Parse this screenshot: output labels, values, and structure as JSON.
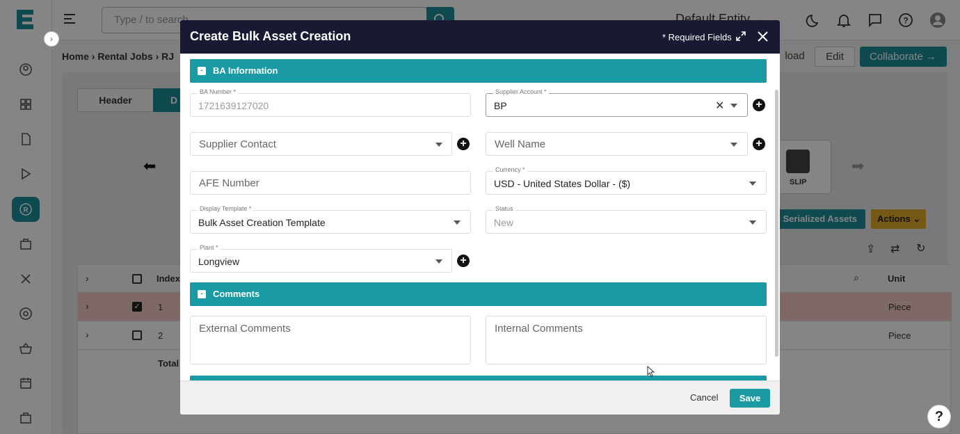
{
  "app": {
    "logo_letter": "E"
  },
  "topbar": {
    "search_placeholder": "Type / to search",
    "entity": "Default Entity"
  },
  "breadcrumb": {
    "home": "Home",
    "sep1": "›",
    "rental_jobs": "Rental Jobs",
    "sep2": "›",
    "current": "RJ"
  },
  "actions": {
    "download": "load",
    "edit": "Edit",
    "collaborate": "Collaborate"
  },
  "tabs": {
    "header": "Header",
    "details": "D"
  },
  "slip": {
    "label": "SLIP"
  },
  "bar_buttons": {
    "assign": "gn Serialized Assets",
    "actions": "Actions"
  },
  "grid": {
    "columns": {
      "index": "Index",
      "unit": "Unit"
    },
    "rows": [
      {
        "index": "1",
        "unit": "Piece",
        "checked": true
      },
      {
        "index": "2",
        "unit": "Piece",
        "checked": false
      }
    ],
    "total": "Total"
  },
  "modal": {
    "title": "Create Bulk Asset Creation",
    "required": "* Required Fields",
    "sections": {
      "ba_info": "BA Information",
      "comments": "Comments"
    },
    "fields": {
      "ba_number": {
        "label": "BA Number *",
        "value": "1721639127020"
      },
      "supplier_account": {
        "label": "Supplier Account *",
        "value": "BP"
      },
      "supplier_contact": {
        "placeholder": "Supplier Contact"
      },
      "well_name": {
        "placeholder": "Well Name"
      },
      "afe_number": {
        "placeholder": "AFE Number"
      },
      "currency": {
        "label": "Currency *",
        "value": "USD - United States Dollar - ($)"
      },
      "display_template": {
        "label": "Display Template *",
        "value": "Bulk Asset Creation Template"
      },
      "status": {
        "label": "Status",
        "value": "New"
      },
      "plant": {
        "label": "Plant *",
        "value": "Longview"
      },
      "external_comments": {
        "placeholder": "External Comments"
      },
      "internal_comments": {
        "placeholder": "Internal Comments"
      }
    },
    "footer": {
      "cancel": "Cancel",
      "save": "Save"
    }
  },
  "help": "?",
  "colors": {
    "accent": "#1d8e99",
    "modal_header": "#181a33",
    "section": "#1a9ba3",
    "actions_btn": "#e0a92a",
    "selected_row": "#f2c9c3"
  }
}
